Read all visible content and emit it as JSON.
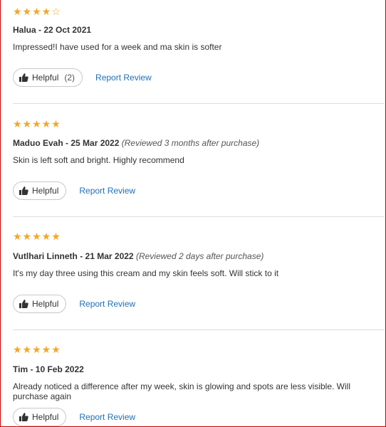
{
  "reviews": [
    {
      "stars": "★★★★",
      "stars_empty": "☆",
      "author": "Halua - 22 Oct 2021",
      "meta": "",
      "text": "Impressed!I have used for a week and ma skin is softer",
      "helpful_label": "Helpful",
      "helpful_count": "(2)",
      "report_label": "Report Review"
    },
    {
      "stars": "★★★★★",
      "stars_empty": "",
      "author": "Maduo Evah - 25 Mar 2022",
      "meta": "(Reviewed 3 months after purchase)",
      "text": "Skin is left soft and bright. Highly recommend",
      "helpful_label": "Helpful",
      "helpful_count": "",
      "report_label": "Report Review"
    },
    {
      "stars": "★★★★★",
      "stars_empty": "",
      "author": "Vutlhari Linneth - 21 Mar 2022",
      "meta": "(Reviewed 2 days after purchase)",
      "text": "It's my day three using this cream and my skin feels soft. Will stick to it",
      "helpful_label": "Helpful",
      "helpful_count": "",
      "report_label": "Report Review"
    },
    {
      "stars": "★★★★★",
      "stars_empty": "",
      "author": "Tim - 10 Feb 2022",
      "meta": "",
      "text": "Already noticed a difference after my week, skin is glowing and spots are less visible. Will purchase again",
      "helpful_label": "Helpful",
      "helpful_count": "",
      "report_label": "Report Review"
    }
  ],
  "ratings": [
    4,
    5,
    5,
    5
  ],
  "colors": {
    "star": "#f5a623",
    "link": "#1f6fb5",
    "border": "#cc0000"
  }
}
